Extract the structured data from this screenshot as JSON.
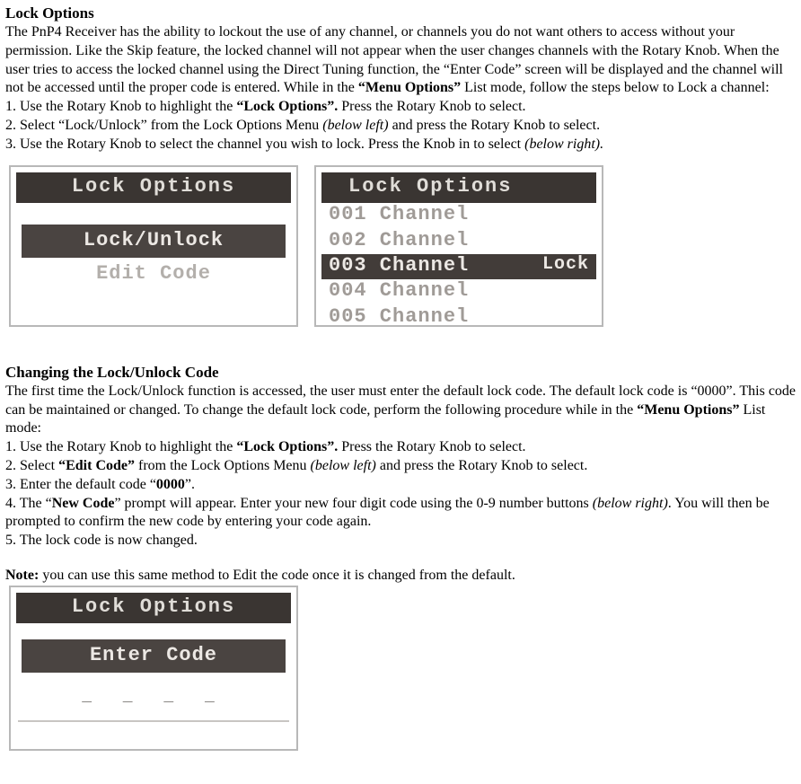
{
  "section1": {
    "heading": "Lock Options",
    "p1a": "The PnP4 Receiver has the ability to lockout the use of any channel, or channels you do not want others to access without your permission. Like the Skip feature, the locked channel will not appear when the user changes channels with the Rotary Knob. When the user tries to access the locked channel using the Direct Tuning function, the “Enter Code” screen will be displayed and the channel will not be accessed until the proper code is entered. While in the ",
    "p1b": "“Menu Options”",
    "p1c": " List mode, follow the steps below to Lock a channel:",
    "s1a": "1. Use the Rotary Knob to highlight the ",
    "s1b": "“Lock Options”.",
    "s1c": " Press the Rotary Knob to select.",
    "s2a": "2. Select “Lock/Unlock” from the Lock Options Menu ",
    "s2b": "(below left)",
    "s2c": " and press the Rotary Knob to select.",
    "s3a": "3. Use the Rotary Knob to select the channel you wish to lock. Press the Knob in to select ",
    "s3b": "(below right).",
    "lcdA": {
      "title": "Lock Options",
      "item1": "Lock/Unlock",
      "item2": "Edit Code"
    },
    "lcdB": {
      "title": "Lock Options",
      "ch1": "001 Channel",
      "ch2": "002 Channel",
      "ch3": "003 Channel",
      "ch3tag": "Lock",
      "ch4": "004 Channel",
      "ch5": "005 Channel"
    }
  },
  "section2": {
    "heading": "Changing the Lock/Unlock Code",
    "p1a": "The first time the Lock/Unlock function is accessed, the user must enter the default lock code. The default lock code is “0000”. This code can be maintained or changed. To change the default lock code, perform the following procedure while in the ",
    "p1b": "“Menu Options”",
    "p1c": " List mode:",
    "s1a": "1. Use the Rotary Knob to highlight the ",
    "s1b": "“Lock Options”.",
    "s1c": " Press the Rotary Knob to select.",
    "s2a": "2. Select ",
    "s2b": "“Edit Code”",
    "s2c": " from the Lock Options Menu ",
    "s2d": "(below left)",
    "s2e": " and press the Rotary Knob to select.",
    "s3a": "3. Enter the default code “",
    "s3b": "0000",
    "s3c": "”.",
    "s4a": "4. The “",
    "s4b": "New Code",
    "s4c": "” prompt will appear. Enter your new four digit code using the 0-9 number buttons ",
    "s4d": "(below right)",
    "s4e": ". You will then be prompted to confirm the new code by entering your code again.",
    "s5": "5. The lock code is now changed.",
    "note_a": "Note:",
    "note_b": " you can use this same method to Edit the code once it is changed from the default.",
    "lcdC": {
      "title": "Lock Options",
      "enter": "Enter Code",
      "digits": "_ _ _ _"
    }
  }
}
